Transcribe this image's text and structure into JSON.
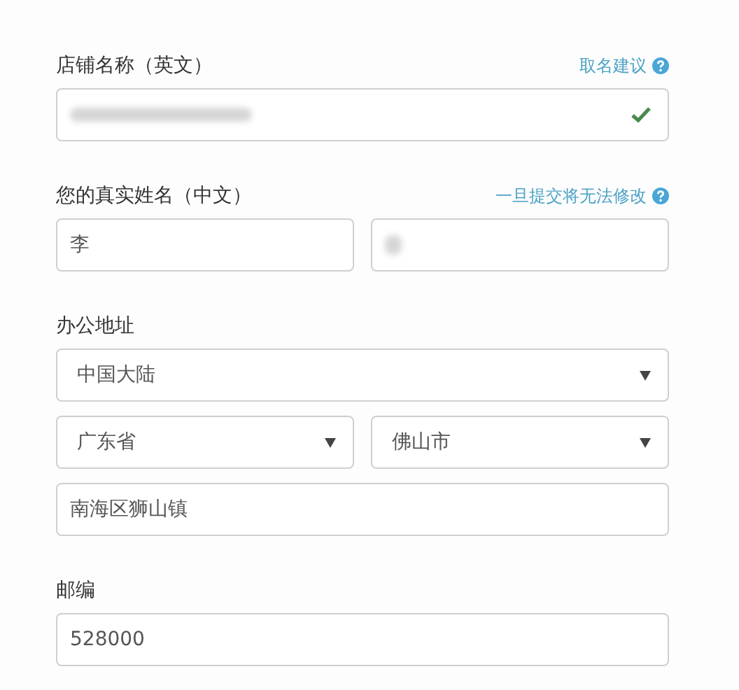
{
  "sections": [
    {
      "label": "店铺名称（英文）",
      "hint": "取名建议",
      "rows": [
        [
          {
            "kind": "blurred",
            "valid": true
          }
        ]
      ]
    },
    {
      "label": "您的真实姓名（中文）",
      "hint": "一旦提交将无法修改",
      "rows": [
        [
          {
            "kind": "text",
            "value": "李"
          },
          {
            "kind": "blurred"
          }
        ]
      ]
    },
    {
      "label": "办公地址",
      "rows": [
        [
          {
            "kind": "select",
            "value": "中国大陆"
          }
        ],
        [
          {
            "kind": "select",
            "value": "广东省"
          },
          {
            "kind": "select",
            "value": "佛山市"
          }
        ],
        [
          {
            "kind": "text",
            "value": "南海区狮山镇"
          }
        ]
      ]
    },
    {
      "label": "邮编",
      "rows": [
        [
          {
            "kind": "text",
            "value": "528000"
          }
        ]
      ]
    }
  ]
}
